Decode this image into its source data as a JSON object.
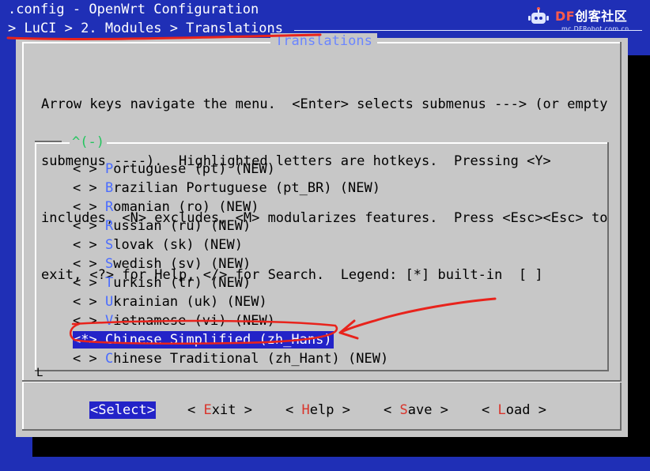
{
  "app": {
    "title_line": ".config - OpenWrt Configuration",
    "breadcrumb": "> LuCI > 2. Modules > Translations"
  },
  "watermark": {
    "brand": "DF创客社区",
    "brand_prefix": "DF",
    "brand_suffix": "创客社区",
    "url": "mc.DFRobot.com.cn",
    "icon": "robot-icon"
  },
  "dialog": {
    "title": "Translations",
    "help_lines": [
      "Arrow keys navigate the menu.  <Enter> selects submenus ---> (or empty",
      "submenus ----).  Highlighted letters are hotkeys.  Pressing <Y>",
      "includes, <N> excludes, <M> modularizes features.  Press <Esc><Esc> to",
      "exit, <?> for Help, </> for Search.  Legend: [*] built-in  [ ]"
    ],
    "scroll_indicator": "^(-)",
    "corner_mark": "L"
  },
  "menu": {
    "items": [
      {
        "box": "< >",
        "hot": "P",
        "rest": "ortuguese (pt) (NEW)",
        "selected": false
      },
      {
        "box": "< >",
        "hot": "B",
        "rest": "razilian Portuguese (pt_BR) (NEW)",
        "selected": false
      },
      {
        "box": "< >",
        "hot": "R",
        "rest": "omanian (ro) (NEW)",
        "selected": false
      },
      {
        "box": "< >",
        "hot": "R",
        "rest": "ussian (ru) (NEW)",
        "selected": false
      },
      {
        "box": "< >",
        "hot": "S",
        "rest": "lovak (sk) (NEW)",
        "selected": false
      },
      {
        "box": "< >",
        "hot": "S",
        "rest": "wedish (sv) (NEW)",
        "selected": false
      },
      {
        "box": "< >",
        "hot": "T",
        "rest": "urkish (tr) (NEW)",
        "selected": false
      },
      {
        "box": "< >",
        "hot": "U",
        "rest": "krainian (uk) (NEW)",
        "selected": false
      },
      {
        "box": "< >",
        "hot": "V",
        "rest": "ietnamese (vi) (NEW)",
        "selected": false
      },
      {
        "box": "<*>",
        "hot": "C",
        "rest": "hinese Simplified (zh_Hans)",
        "selected": true
      },
      {
        "box": "< >",
        "hot": "C",
        "rest": "hinese Traditional (zh_Hant) (NEW)",
        "selected": false
      }
    ]
  },
  "buttons": [
    {
      "pre": "<",
      "hot": "S",
      "rest": "elect",
      "post": ">",
      "active": true
    },
    {
      "pre": "< ",
      "hot": "E",
      "rest": "xit",
      "post": " >",
      "active": false
    },
    {
      "pre": "< ",
      "hot": "H",
      "rest": "elp",
      "post": " >",
      "active": false
    },
    {
      "pre": "< ",
      "hot": "S",
      "rest": "ave",
      "post": " >",
      "active": false
    },
    {
      "pre": "< ",
      "hot": "L",
      "rest": "oad",
      "post": " >",
      "active": false
    }
  ],
  "colors": {
    "terminal_bg": "#1f2fb6",
    "dialog_bg": "#c7c7c7",
    "highlight": "#2323c8",
    "hotkey_menu": "#4a6cff",
    "hotkey_button": "#d9342b",
    "annotation": "#e8231c"
  }
}
